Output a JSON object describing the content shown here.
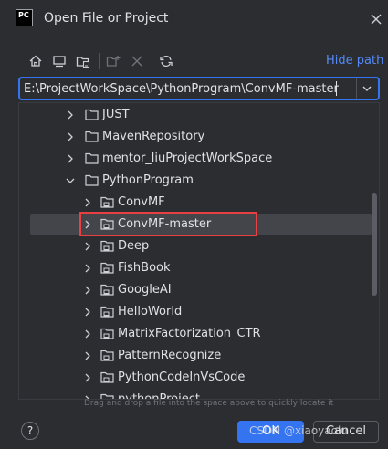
{
  "window": {
    "app_logo_text": "PC",
    "title": "Open File or Project"
  },
  "toolbar": {
    "icons": [
      "home-icon",
      "desktop-icon",
      "project-folder-icon",
      "new-folder-icon",
      "delete-icon",
      "refresh-icon"
    ],
    "hide_path_label": "Hide path"
  },
  "path": {
    "value": "E:\\ProjectWorkSpace\\PythonProgram\\ConvMF-master"
  },
  "tree": {
    "items": [
      {
        "label": "JUST"
      },
      {
        "label": "MavenRepository"
      },
      {
        "label": "mentor_liuProjectWorkSpace"
      },
      {
        "label": "PythonProgram"
      },
      {
        "label": "ConvMF"
      },
      {
        "label": "ConvMF-master"
      },
      {
        "label": "Deep"
      },
      {
        "label": "FishBook"
      },
      {
        "label": "GoogleAI"
      },
      {
        "label": "HelloWorld"
      },
      {
        "label": "MatrixFactorization_CTR"
      },
      {
        "label": "PatternRecognize"
      },
      {
        "label": "PythonCodeInVsCode"
      },
      {
        "label": "pythonProject"
      }
    ]
  },
  "hint": "Drag and drop a file into the space above to quickly locate it",
  "footer": {
    "help_label": "?",
    "ok_label": "OK",
    "cancel_label": "Cancel",
    "watermark": "CSDN @xiaoyaolu"
  },
  "colors": {
    "background": "#2b2d30",
    "accent": "#3574f0",
    "link": "#548af7",
    "selection": "#43454a",
    "highlight_border": "#e84040"
  }
}
